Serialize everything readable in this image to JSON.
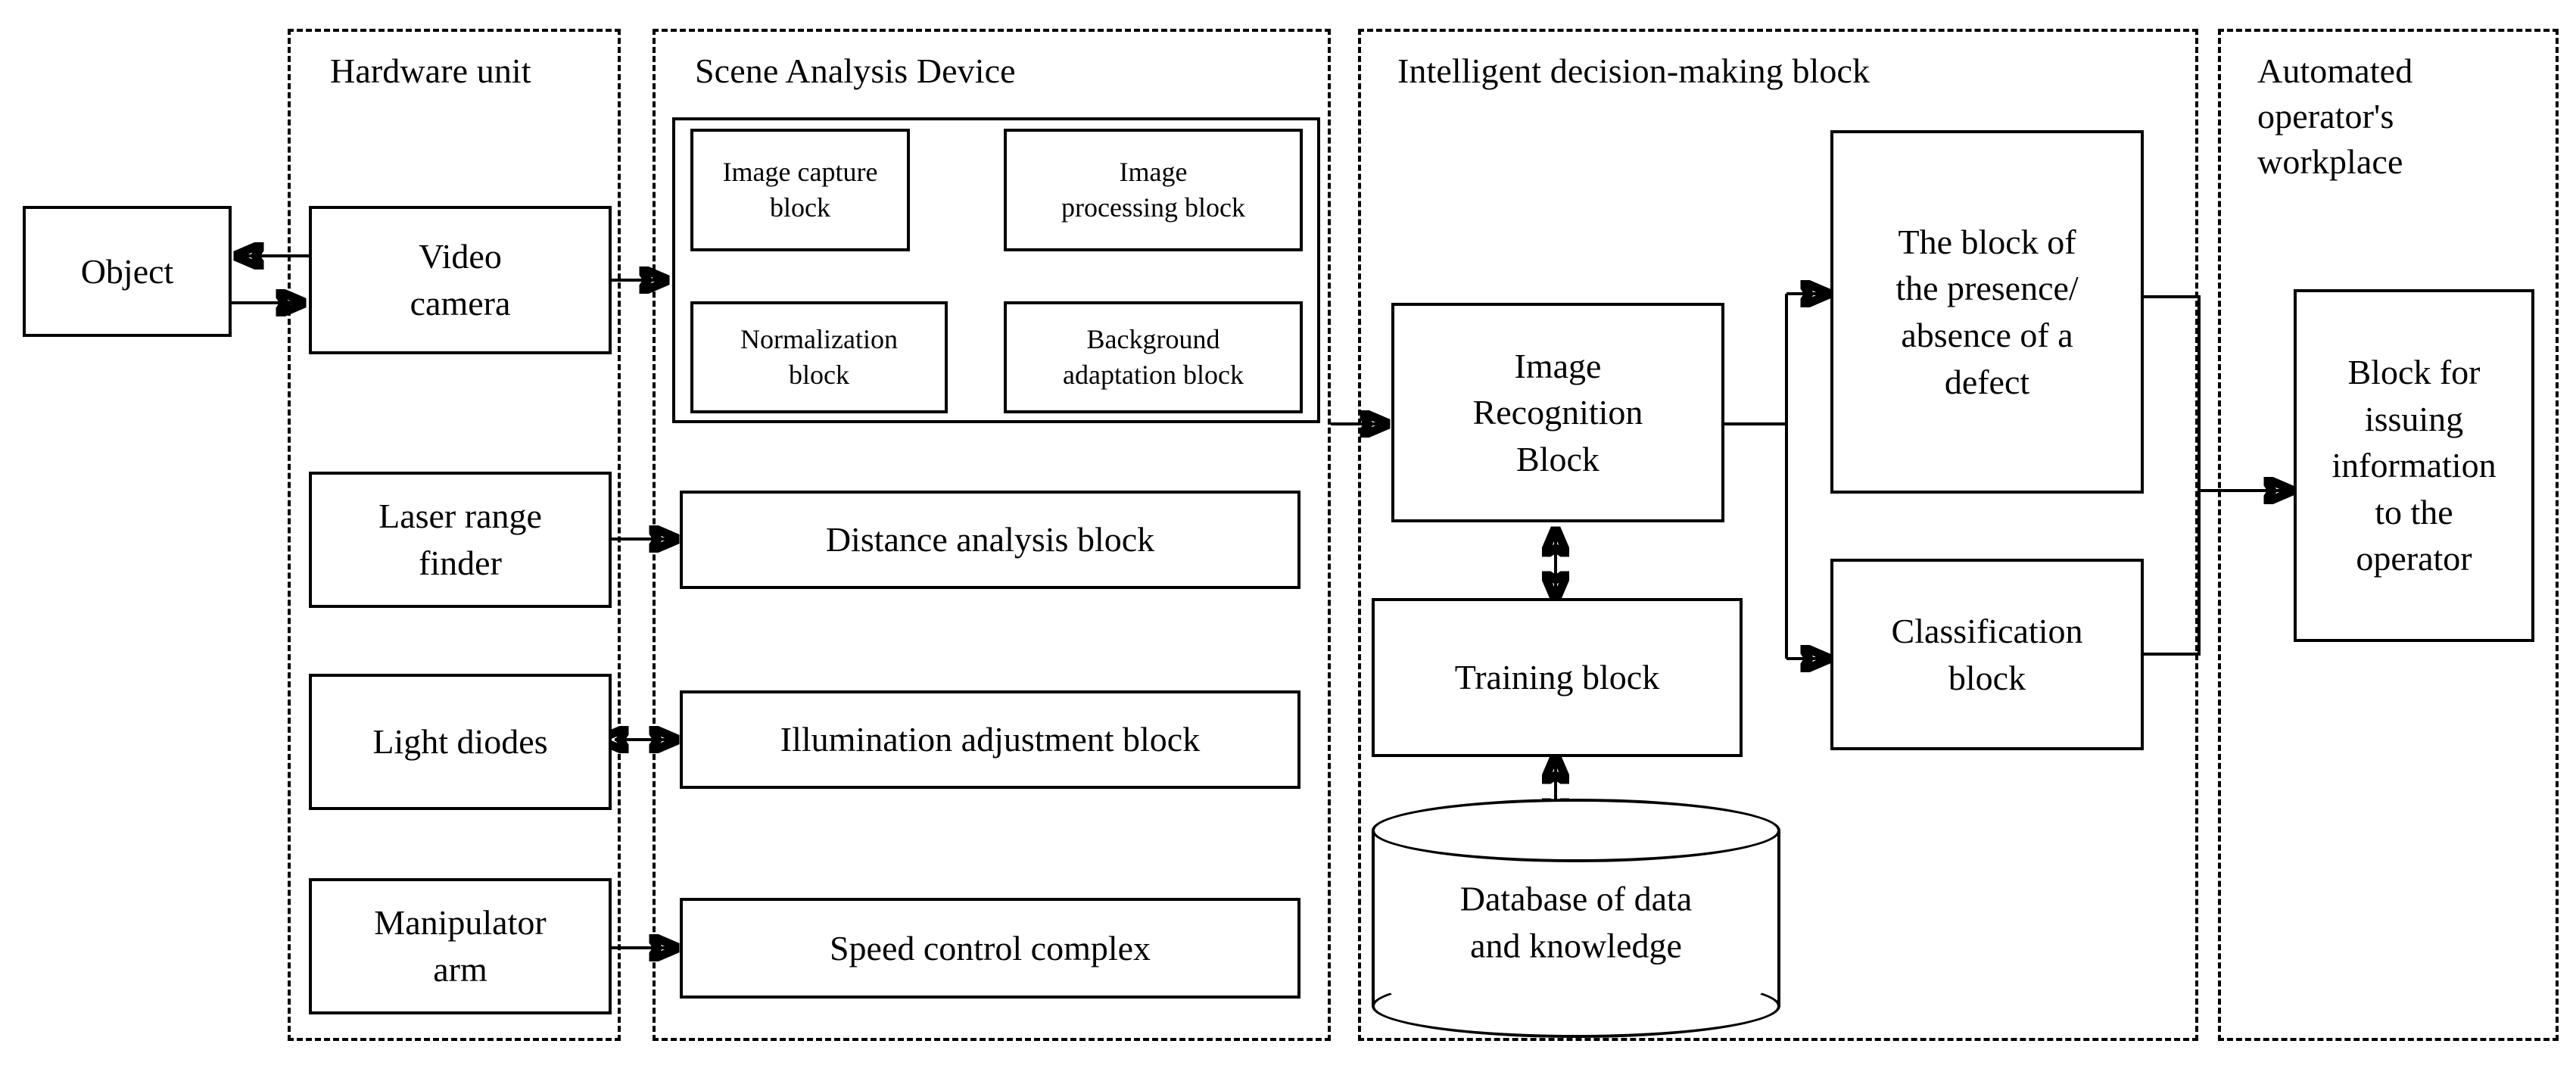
{
  "diagram": {
    "type": "block-diagram",
    "title": "",
    "panels": [
      {
        "id": "hardware_unit",
        "label": "Hardware unit"
      },
      {
        "id": "scene_analysis_device",
        "label": "Scene Analysis Device"
      },
      {
        "id": "intelligent_decision_making_block",
        "label": "Intelligent decision-making block"
      },
      {
        "id": "automated_operators_workplace",
        "label": "Automated\noperator's\nworkplace"
      }
    ],
    "nodes": {
      "object": "Object",
      "video_camera": "Video\ncamera",
      "laser_range_finder": "Laser range\nfinder",
      "light_diodes": "Light diodes",
      "manipulator_arm": "Manipulator\narm",
      "image_capture_block": "Image capture\nblock",
      "image_processing_block": "Image\nprocessing block",
      "normalization_block": "Normalization\nblock",
      "background_adaptation_block": "Background\nadaptation block",
      "distance_analysis_block": "Distance analysis block",
      "illumination_adjustment_block": "Illumination adjustment block",
      "speed_control_complex": "Speed control complex",
      "image_recognition_block": "Image\nRecognition\nBlock",
      "training_block": "Training block",
      "database_of_data_and_knowledge": "Database of data\nand knowledge",
      "presence_absence_defect_block": "The block of\nthe presence/\nabsence of a\ndefect",
      "classification_block": "Classification\nblock",
      "block_for_issuing_information": "Block for\nissuing\ninformation\nto the\noperator"
    },
    "edges": [
      {
        "from": "video_camera",
        "to": "object",
        "direction": "one-way"
      },
      {
        "from": "object",
        "to": "video_camera",
        "direction": "one-way"
      },
      {
        "from": "video_camera",
        "to": "image_capture_block",
        "direction": "one-way"
      },
      {
        "from": "image_capture_block",
        "to": "image_processing_block",
        "direction": "one-way"
      },
      {
        "from": "image_processing_block",
        "to": "background_adaptation_block",
        "direction": "one-way"
      },
      {
        "from": "background_adaptation_block",
        "to": "normalization_block",
        "direction": "one-way"
      },
      {
        "from": "normalization_block",
        "to": "image_capture_block",
        "direction": "one-way"
      },
      {
        "from": "laser_range_finder",
        "to": "distance_analysis_block",
        "direction": "one-way"
      },
      {
        "from": "light_diodes",
        "to": "illumination_adjustment_block",
        "direction": "two-way"
      },
      {
        "from": "manipulator_arm",
        "to": "speed_control_complex",
        "direction": "one-way"
      },
      {
        "from": "scene_analysis_device",
        "to": "image_recognition_block",
        "direction": "one-way"
      },
      {
        "from": "image_recognition_block",
        "to": "training_block",
        "direction": "two-way"
      },
      {
        "from": "training_block",
        "to": "database_of_data_and_knowledge",
        "direction": "two-way"
      },
      {
        "from": "image_recognition_block",
        "to": "presence_absence_defect_block",
        "direction": "one-way"
      },
      {
        "from": "image_recognition_block",
        "to": "classification_block",
        "direction": "one-way"
      },
      {
        "from": "presence_absence_defect_block",
        "to": "block_for_issuing_information",
        "direction": "one-way"
      },
      {
        "from": "classification_block",
        "to": "block_for_issuing_information",
        "direction": "one-way"
      }
    ],
    "colors": {
      "stroke": "#000000",
      "background": "#ffffff"
    }
  }
}
